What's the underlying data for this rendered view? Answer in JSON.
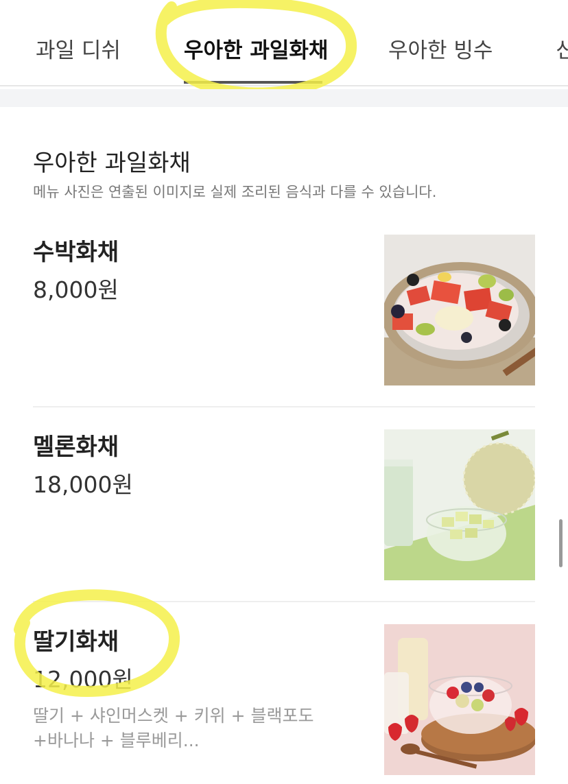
{
  "tabs": [
    {
      "label": "과일 디쉬"
    },
    {
      "label": "우아한 과일화채"
    },
    {
      "label": "우아한 빙수"
    },
    {
      "label": "신"
    }
  ],
  "section": {
    "title": "우아한 과일화채",
    "note": "메뉴 사진은 연출된 이미지로 실제 조리된 음식과 다를 수 있습니다."
  },
  "items": [
    {
      "name": "수박화채",
      "price": "8,000원",
      "description": ""
    },
    {
      "name": "멜론화채",
      "price": "18,000원",
      "description": ""
    },
    {
      "name": "딸기화채",
      "price": "12,000원",
      "description": "딸기 + 샤인머스켓 + 키위 + 블랙포도 +바나나 + 블루베리..."
    }
  ],
  "colors": {
    "highlight": "#f4f04a",
    "active_tab_underline": "#555555",
    "spacer": "#f3f4f6"
  }
}
